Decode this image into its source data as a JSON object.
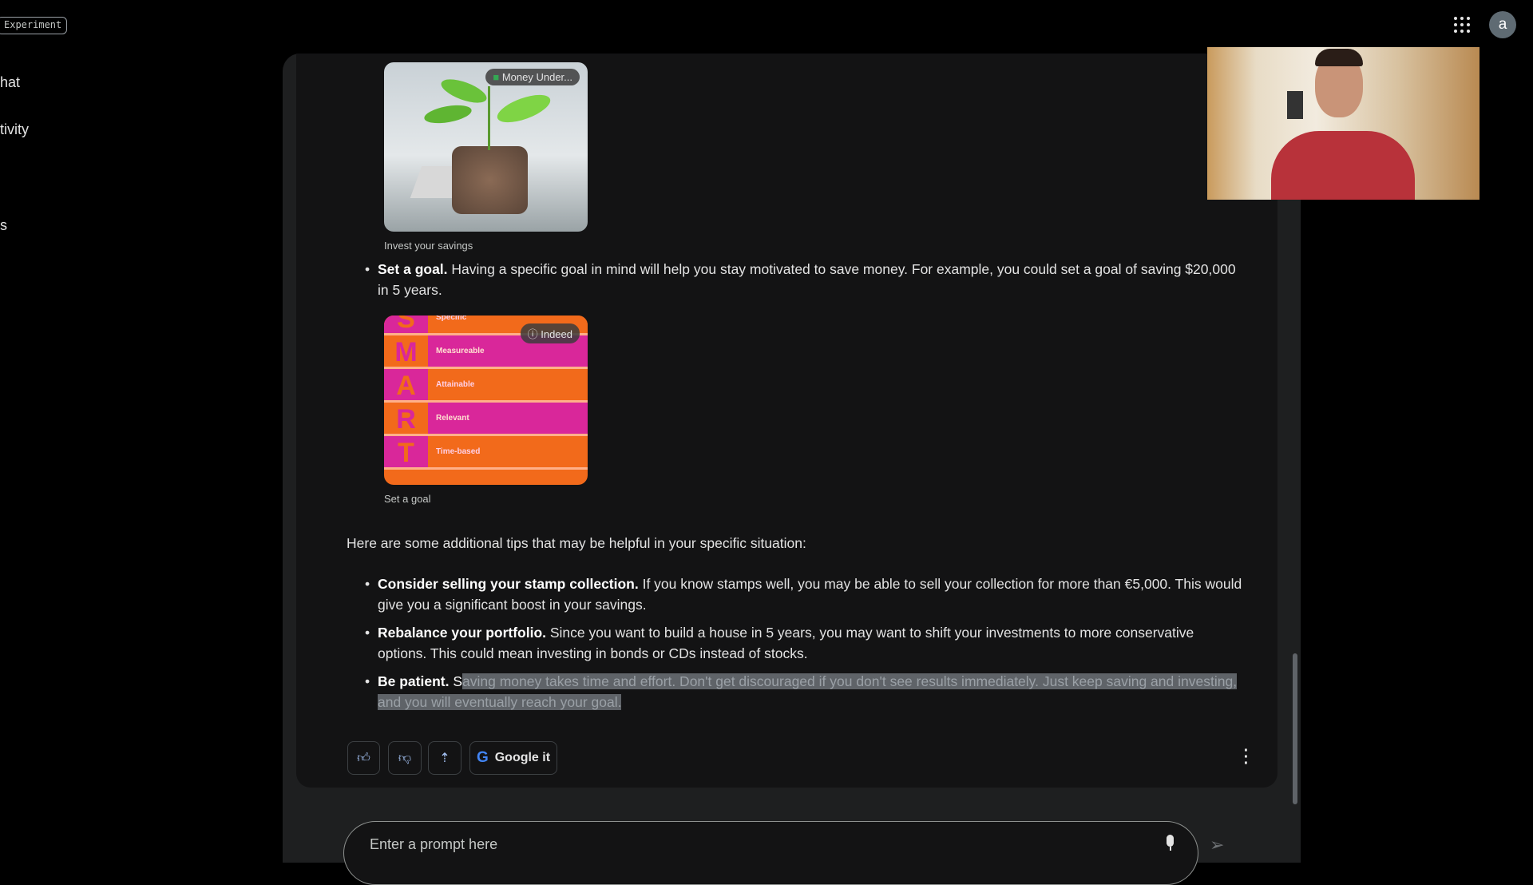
{
  "header": {
    "badge": "Experiment",
    "apps_icon": "apps-grid-icon",
    "avatar_letter": "a"
  },
  "sidebar": {
    "items": [
      {
        "label": "hat"
      },
      {
        "label": "tivity"
      },
      {
        "label": "s"
      }
    ]
  },
  "response": {
    "image1": {
      "source": "Money Under...",
      "caption": "Invest your savings"
    },
    "bullet_goal": {
      "bold": "Set a goal.",
      "text": " Having a specific goal in mind will help you stay motivated to save money. For example, you could set a goal of saving $20,000 in 5 years."
    },
    "image2": {
      "source": "Indeed",
      "caption": "Set a goal",
      "rows": [
        {
          "letter": "S",
          "label": "Specific"
        },
        {
          "letter": "M",
          "label": "Measureable"
        },
        {
          "letter": "A",
          "label": "Attainable"
        },
        {
          "letter": "R",
          "label": "Relevant"
        },
        {
          "letter": "T",
          "label": "Time-based"
        }
      ]
    },
    "intro": "Here are some additional tips that may be helpful in your specific situation:",
    "tips": [
      {
        "bold": "Consider selling your stamp collection.",
        "text": " If you know stamps well, you may be able to sell your collection for more than €5,000. This would give you a significant boost in your savings."
      },
      {
        "bold": "Rebalance your portfolio.",
        "text": " Since you want to build a house in 5 years, you may want to shift your investments to more conservative options. This could mean investing in bonds or CDs instead of stocks."
      },
      {
        "bold": "Be patient.",
        "text_plain": " S",
        "text_selected": "aving money takes time and effort. Don't get discouraged if you don't see results immediately. Just keep saving and investing, and you will eventually reach your goal."
      }
    ],
    "actions": {
      "google_it": "Google it"
    }
  },
  "prompt": {
    "placeholder": "Enter a prompt here"
  },
  "colors": {
    "accent": "#a8c7fa",
    "panel": "#1e1f20",
    "card": "#131314",
    "smart_orange": "#f26a1b",
    "smart_pink": "#d9279a"
  }
}
